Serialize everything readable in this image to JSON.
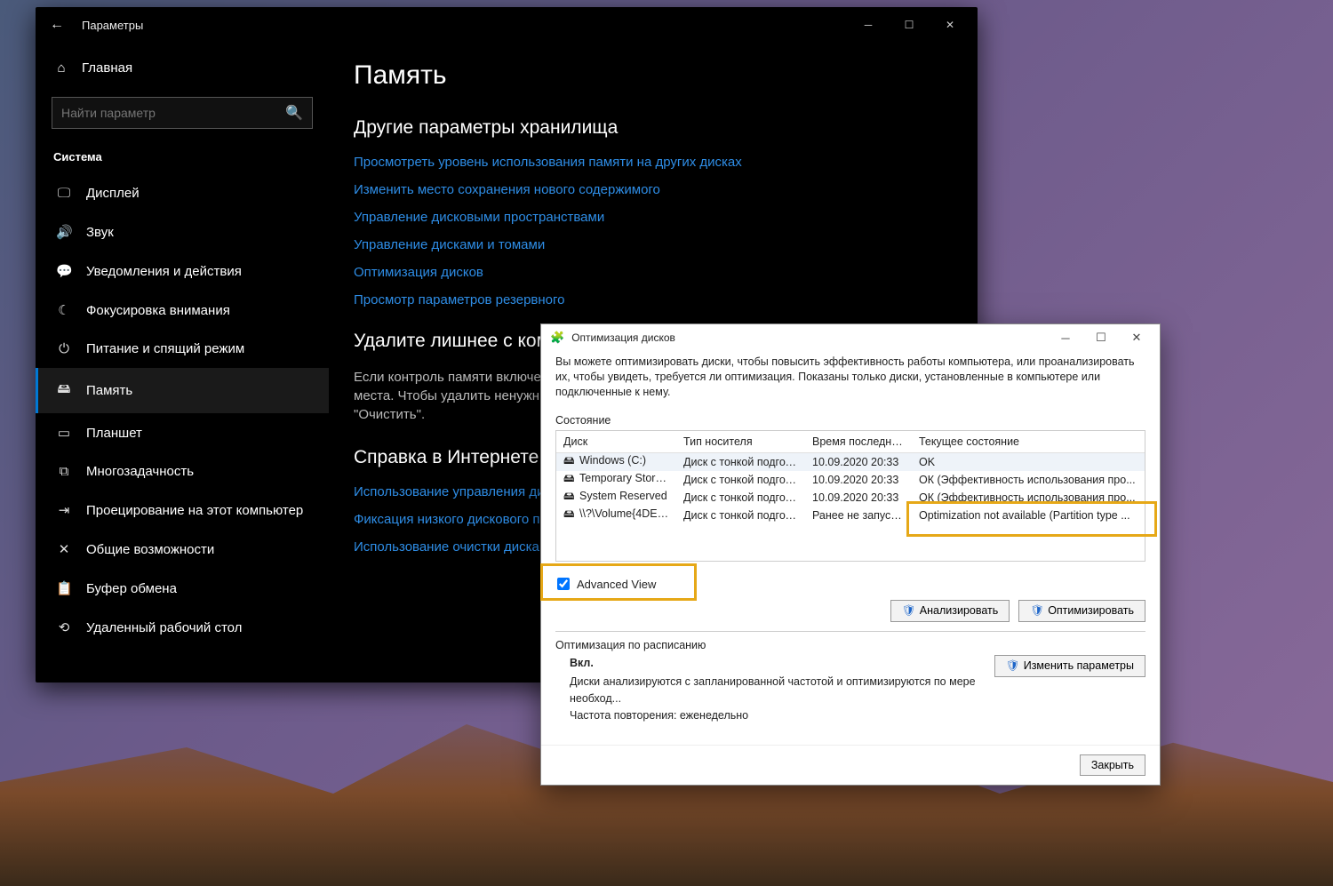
{
  "settings": {
    "window_title": "Параметры",
    "home": "Главная",
    "search_placeholder": "Найти параметр",
    "group": "Система",
    "nav": [
      {
        "icon": "🖵",
        "label": "Дисплей"
      },
      {
        "icon": "🔊",
        "label": "Звук"
      },
      {
        "icon": "💬",
        "label": "Уведомления и действия"
      },
      {
        "icon": "☾",
        "label": "Фокусировка внимания"
      },
      {
        "icon": "⏻",
        "label": "Питание и спящий режим"
      },
      {
        "icon": "🖴",
        "label": "Память"
      },
      {
        "icon": "▭",
        "label": "Планшет"
      },
      {
        "icon": "⧉",
        "label": "Многозадачность"
      },
      {
        "icon": "⇥",
        "label": "Проецирование на этот компьютер"
      },
      {
        "icon": "✕",
        "label": "Общие возможности"
      },
      {
        "icon": "📋",
        "label": "Буфер обмена"
      },
      {
        "icon": "⟲",
        "label": "Удаленный рабочий стол"
      }
    ],
    "active_index": 5,
    "page_heading": "Память",
    "section1": "Другие параметры хранилища",
    "links1": [
      "Просмотреть уровень использования памяти на других дисках",
      "Изменить место сохранения нового содержимого",
      "Управление дисковыми пространствами",
      "Управление дисками и томами",
      "Оптимизация дисков",
      "Просмотр параметров резервного"
    ],
    "section2": "Удалите лишнее с компь",
    "section2_body": "Если контроль памяти включен, он сработает если на устройстве недостаточно места. Чтобы удалить ненужные файлы сейчас, выберите запустить его\" > \"Очистить\".",
    "section3": "Справка в Интернете",
    "links3": [
      "Использование управления дисками",
      "Фиксация низкого дискового простр",
      "Использование очистки диска"
    ]
  },
  "dialog": {
    "title": "Оптимизация дисков",
    "intro": "Вы можете оптимизировать диски, чтобы повысить эффективность работы  компьютера, или проанализировать их, чтобы увидеть, требуется ли оптимизация. Показаны только диски, установленные в компьютере или подключенные к нему.",
    "state": "Состояние",
    "columns": {
      "disk": "Диск",
      "media": "Тип носителя",
      "last": "Время последнег...",
      "status": "Текущее состояние"
    },
    "rows": [
      {
        "icon": "🖴",
        "disk": "Windows (C:)",
        "media": "Диск с тонкой подгото...",
        "last": "10.09.2020 20:33",
        "status": "OK"
      },
      {
        "icon": "🖴",
        "disk": "Temporary Storage...",
        "media": "Диск с тонкой подгото...",
        "last": "10.09.2020 20:33",
        "status": "ОК (Эффективность использования про..."
      },
      {
        "icon": "🖴",
        "disk": "System Reserved",
        "media": "Диск с тонкой подгото...",
        "last": "10.09.2020 20:33",
        "status": "ОК (Эффективность использования про..."
      },
      {
        "icon": "🖴",
        "disk": "\\\\?\\Volume{4DE89...",
        "media": "Диск с тонкой подгото...",
        "last": "Ранее не запуска...",
        "status": "Optimization not available (Partition type ..."
      }
    ],
    "advanced_view": "Advanced View",
    "advanced_checked": true,
    "analyze": "Анализировать",
    "optimize": "Оптимизировать",
    "sched_heading": "Оптимизация по расписанию",
    "sched_on": "Вкл.",
    "sched_line1": "Диски анализируются с запланированной частотой и оптимизируются по мере необход...",
    "sched_line2": "Частота повторения: еженедельно",
    "change": "Изменить параметры",
    "close": "Закрыть"
  }
}
